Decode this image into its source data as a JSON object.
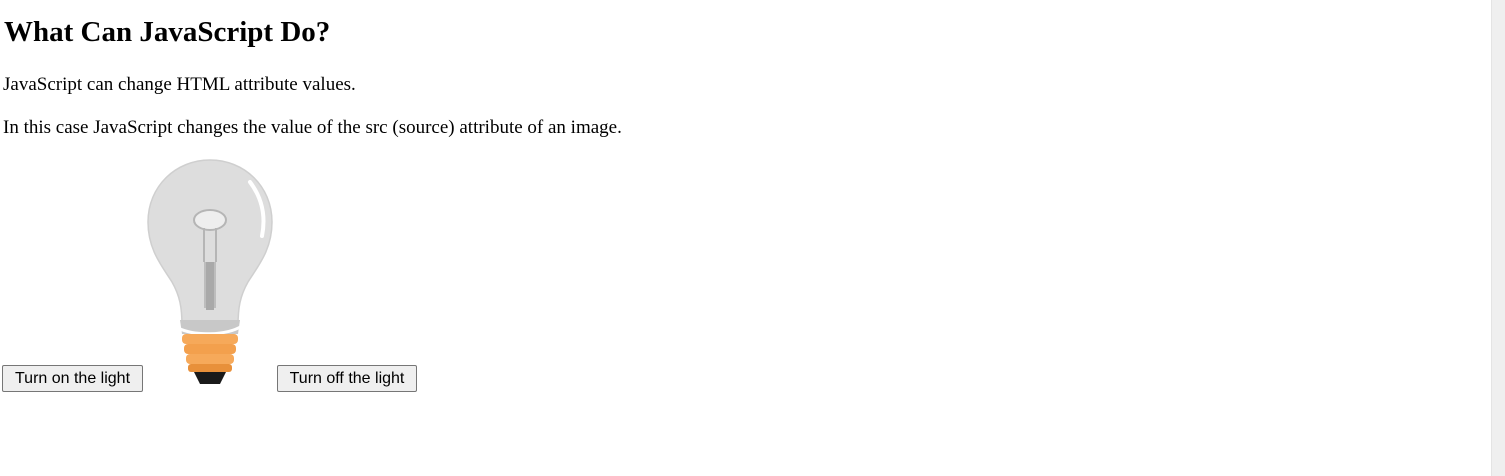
{
  "heading": "What Can JavaScript Do?",
  "paragraphs": [
    "JavaScript can change HTML attribute values.",
    "In this case JavaScript changes the value of the src (source) attribute of an image."
  ],
  "buttons": {
    "turn_on": "Turn on the light",
    "turn_off": "Turn off the light"
  },
  "image": {
    "icon": "lightbulb-off-icon",
    "state": "off"
  },
  "colors": {
    "bulb_glass": "#dcdcdc",
    "bulb_base": "#f5a857",
    "button_bg": "#efefef",
    "scrollbar": "#efefef"
  }
}
